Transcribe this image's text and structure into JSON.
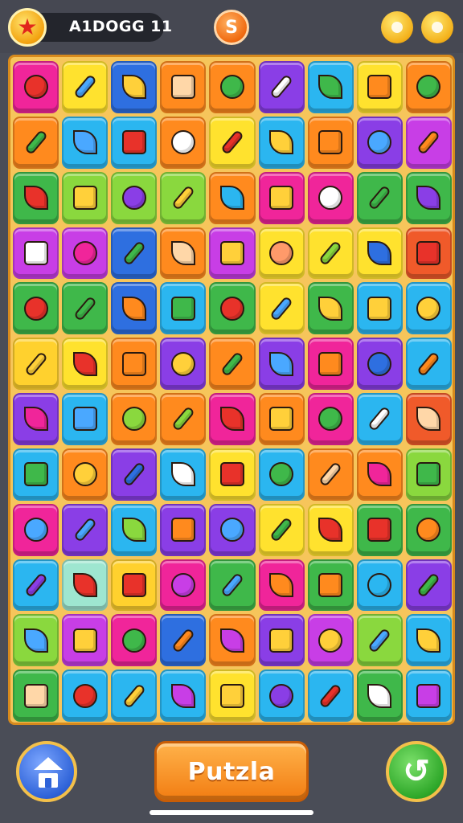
{
  "header": {
    "score_text": "A1DOGG 11",
    "coin_label": "S",
    "star_icon": "star-icon",
    "settings_icons": [
      "gear-icon",
      "gear-icon"
    ]
  },
  "footer": {
    "home_icon": "home-icon",
    "puzzle_label": "Putzla",
    "undo_icon": "undo-icon"
  },
  "board": {
    "columns": 9,
    "rows": 12,
    "tiles": [
      [
        "#f0259a",
        "#ffe22e",
        "#2e6fe0",
        "#ff8a1e",
        "#ff8a1e",
        "#8a3ee6",
        "#2bb6f0",
        "#ffe22e",
        "#ff8a1e"
      ],
      [
        "#ff8a1e",
        "#2bb6f0",
        "#2bb6f0",
        "#ff8a1e",
        "#ffe22e",
        "#2bb6f0",
        "#ff8a1e",
        "#8a3ee6",
        "#c83ee6"
      ],
      [
        "#3fb84a",
        "#8ad83e",
        "#8ad83e",
        "#8ad83e",
        "#ff8a1e",
        "#f0259a",
        "#f0259a",
        "#3fb84a",
        "#3fb84a"
      ],
      [
        "#c83ee6",
        "#c83ee6",
        "#2e6fe0",
        "#ff8a1e",
        "#c83ee6",
        "#ffe22e",
        "#ffe22e",
        "#ffe22e",
        "#f05a2a"
      ],
      [
        "#3fb84a",
        "#3fb84a",
        "#2e6fe0",
        "#2bb6f0",
        "#3fb84a",
        "#ffe22e",
        "#3fb84a",
        "#2bb6f0",
        "#2bb6f0"
      ],
      [
        "#ffd12e",
        "#ffe22e",
        "#ff8a1e",
        "#8a3ee6",
        "#ff8a1e",
        "#8a3ee6",
        "#f0259a",
        "#8a3ee6",
        "#2bb6f0"
      ],
      [
        "#8a3ee6",
        "#2bb6f0",
        "#ff8a1e",
        "#ff8a1e",
        "#f0259a",
        "#ff8a1e",
        "#f0259a",
        "#2bb6f0",
        "#f05a2a"
      ],
      [
        "#2bb6f0",
        "#ff8a1e",
        "#8a3ee6",
        "#2bb6f0",
        "#ffe22e",
        "#2bb6f0",
        "#ff8a1e",
        "#ff8a1e",
        "#8ad83e"
      ],
      [
        "#f0259a",
        "#8a3ee6",
        "#2bb6f0",
        "#8a3ee6",
        "#8a3ee6",
        "#ffe22e",
        "#ffe22e",
        "#3fb84a",
        "#3fb84a"
      ],
      [
        "#2bb6f0",
        "#9ee6d0",
        "#ffd12e",
        "#f0259a",
        "#3fb84a",
        "#f0259a",
        "#3fb84a",
        "#2bb6f0",
        "#8a3ee6"
      ],
      [
        "#8ad83e",
        "#c83ee6",
        "#f0259a",
        "#2e6fe0",
        "#ff8a1e",
        "#8a3ee6",
        "#c83ee6",
        "#8ad83e",
        "#2bb6f0"
      ],
      [
        "#3fb84a",
        "#2bb6f0",
        "#2bb6f0",
        "#2bb6f0",
        "#ffe22e",
        "#2bb6f0",
        "#2bb6f0",
        "#3fb84a",
        "#2bb6f0"
      ]
    ],
    "glyphs": [
      [
        "#e8322a",
        "#4aa8ff",
        "#ffd03a",
        "#ffd7a8",
        "#3fb84a",
        "#ffffff",
        "#3fb84a",
        "#ff8a1e",
        "#3fb84a"
      ],
      [
        "#3fb84a",
        "#4aa8ff",
        "#e8322a",
        "#ffffff",
        "#e8322a",
        "#ffd03a",
        "#ff8a1e",
        "#4aa8ff",
        "#ff8a1e"
      ],
      [
        "#e8322a",
        "#ffd03a",
        "#8a3ee6",
        "#ffd03a",
        "#2bb6f0",
        "#ffd03a",
        "#ffffff",
        "#3fb84a",
        "#8a3ee6"
      ],
      [
        "#ffffff",
        "#f0259a",
        "#3fb84a",
        "#ffd7a8",
        "#ffd03a",
        "#ff9a6a",
        "#8ad83e",
        "#2e6fe0",
        "#e8322a"
      ],
      [
        "#e8322a",
        "#3fb84a",
        "#ff8a1e",
        "#3fb84a",
        "#e8322a",
        "#4aa8ff",
        "#ffd03a",
        "#ffd03a",
        "#ffd03a"
      ],
      [
        "#ffd03a",
        "#e8322a",
        "#ff8a1e",
        "#ffd03a",
        "#3fb84a",
        "#4aa8ff",
        "#ff8a1e",
        "#2e6fe0",
        "#ff8a1e"
      ],
      [
        "#f0259a",
        "#4aa8ff",
        "#8ad83e",
        "#8ad83e",
        "#e8322a",
        "#ffd03a",
        "#3fb84a",
        "#ffffff",
        "#ffd7a8"
      ],
      [
        "#3fb84a",
        "#ffd03a",
        "#2e6fe0",
        "#ffffff",
        "#e8322a",
        "#3fb84a",
        "#ffd7a8",
        "#f0259a",
        "#3fb84a"
      ],
      [
        "#4aa8ff",
        "#4aa8ff",
        "#8ad83e",
        "#ff8a1e",
        "#4aa8ff",
        "#3fb84a",
        "#e8322a",
        "#e8322a",
        "#ff8a1e"
      ],
      [
        "#8a3ee6",
        "#e8322a",
        "#e8322a",
        "#c83ee6",
        "#4aa8ff",
        "#ff8a1e",
        "#ff8a1e",
        "#2bb6f0",
        "#3fb84a"
      ],
      [
        "#4aa8ff",
        "#ffd03a",
        "#3fb84a",
        "#ff8a1e",
        "#c83ee6",
        "#ffd03a",
        "#ffd03a",
        "#4aa8ff",
        "#ffd03a"
      ],
      [
        "#ffd7a8",
        "#e8322a",
        "#ffd03a",
        "#c83ee6",
        "#ffd03a",
        "#8a3ee6",
        "#e8322a",
        "#ffffff",
        "#c83ee6"
      ]
    ]
  }
}
